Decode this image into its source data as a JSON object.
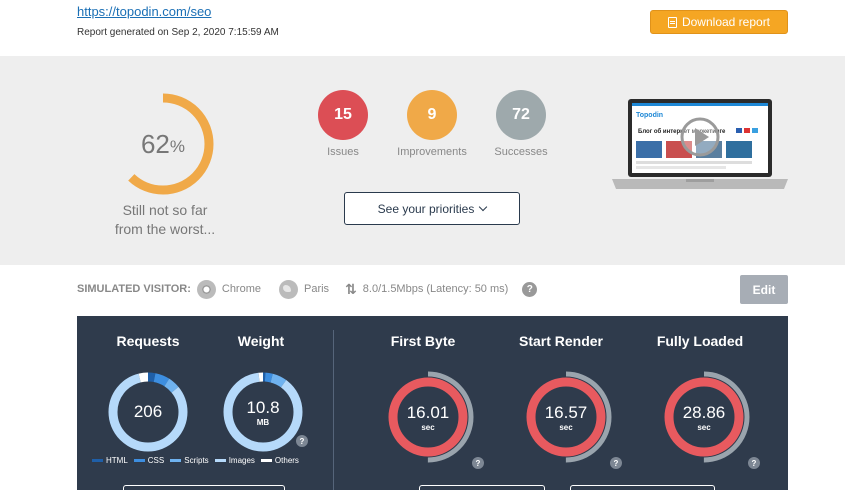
{
  "header": {
    "url": "https://topodin.com/seo",
    "generated": "Report generated on Sep 2, 2020 7:15:59 AM",
    "download_label": "Download report"
  },
  "summary": {
    "score": "62",
    "score_unit": "%",
    "score_value": 62,
    "caption_line1": "Still not so far",
    "caption_line2": "from the worst...",
    "issues": {
      "count": "15",
      "label": "Issues",
      "color": "#dc4e55"
    },
    "improvements": {
      "count": "9",
      "label": "Improvements",
      "color": "#f0a948"
    },
    "successes": {
      "count": "72",
      "label": "Successes",
      "color": "#9ea9ac"
    },
    "priorities_label": "See your priorities"
  },
  "preview": {
    "site_logo": "Topodin",
    "banner_text": "Блог об интернет маркетинге"
  },
  "visitor": {
    "heading": "SIMULATED VISITOR:",
    "browser": "Chrome",
    "location": "Paris",
    "connection": "8.0/1.5Mbps (Latency: 50 ms)",
    "help": "?",
    "edit_label": "Edit"
  },
  "performance": {
    "requests": {
      "title": "Requests",
      "value": "206"
    },
    "weight": {
      "title": "Weight",
      "value": "10.8",
      "unit": "MB"
    },
    "first_byte": {
      "title": "First Byte",
      "value": "16.01",
      "unit": "sec"
    },
    "start_render": {
      "title": "Start Render",
      "value": "16.57",
      "unit": "sec"
    },
    "fully_loaded": {
      "title": "Fully Loaded",
      "value": "28.86",
      "unit": "sec"
    },
    "legend": [
      {
        "label": "HTML",
        "color": "#1f5fa8"
      },
      {
        "label": "CSS",
        "color": "#3d8ee0"
      },
      {
        "label": "Scripts",
        "color": "#6fb2ef"
      },
      {
        "label": "Images",
        "color": "#b5d9fa"
      },
      {
        "label": "Others",
        "color": "#ffffff"
      }
    ],
    "help": "?"
  },
  "colors": {
    "accent": "#f5a623",
    "panel": "#2f3b4c",
    "time_ring": "#e85a5f",
    "time_track": "#9aa4ad"
  }
}
